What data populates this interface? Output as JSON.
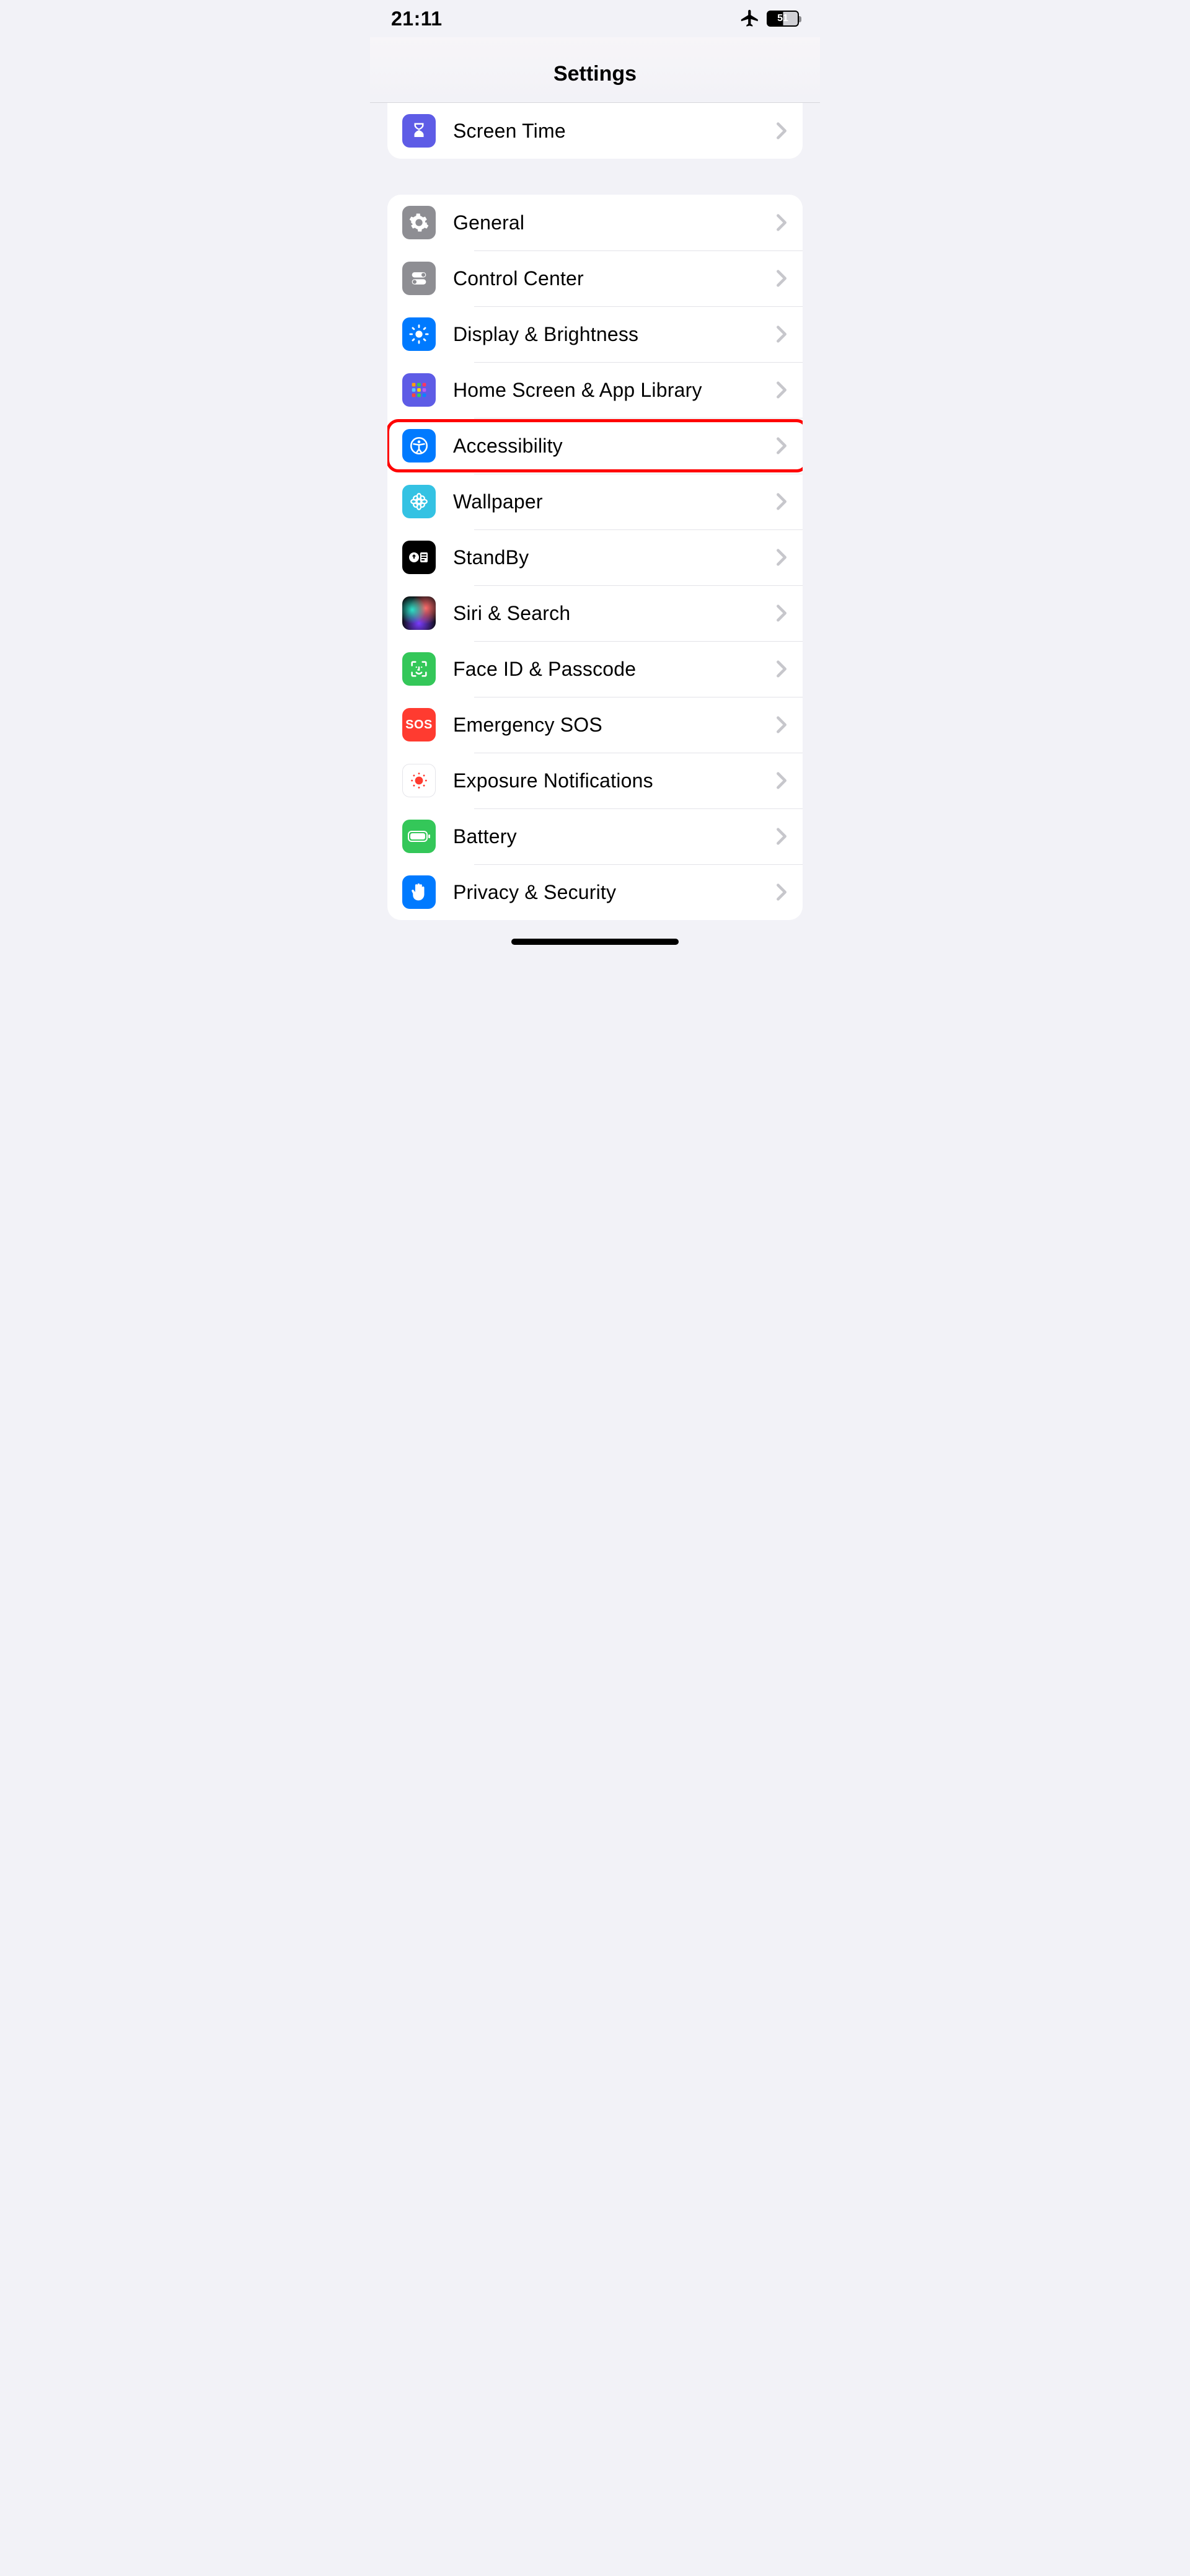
{
  "status": {
    "time": "21:11",
    "battery": "51"
  },
  "header": {
    "title": "Settings"
  },
  "group1": {
    "items": [
      {
        "label": "Screen Time",
        "icon": "hourglass-icon",
        "bg": "#5e5ce6"
      }
    ]
  },
  "group2": {
    "items": [
      {
        "label": "General",
        "icon": "gear-icon",
        "bg": "#8e8e93"
      },
      {
        "label": "Control Center",
        "icon": "switches-icon",
        "bg": "#8e8e93"
      },
      {
        "label": "Display & Brightness",
        "icon": "sun-icon",
        "bg": "#007aff"
      },
      {
        "label": "Home Screen & App Library",
        "icon": "app-grid-icon",
        "bg": "#5e5ce6"
      },
      {
        "label": "Accessibility",
        "icon": "accessibility-icon",
        "bg": "#007aff",
        "highlighted": true
      },
      {
        "label": "Wallpaper",
        "icon": "flower-icon",
        "bg": "#34c2e3"
      },
      {
        "label": "StandBy",
        "icon": "standby-icon",
        "bg": "#000000"
      },
      {
        "label": "Siri & Search",
        "icon": "siri-icon",
        "bg": "siri"
      },
      {
        "label": "Face ID & Passcode",
        "icon": "faceid-icon",
        "bg": "#34c759"
      },
      {
        "label": "Emergency SOS",
        "icon": "sos-icon",
        "bg": "#ff3b30"
      },
      {
        "label": "Exposure Notifications",
        "icon": "exposure-icon",
        "bg": "#ffffff",
        "border": true
      },
      {
        "label": "Battery",
        "icon": "battery-icon",
        "bg": "#34c759"
      },
      {
        "label": "Privacy & Security",
        "icon": "hand-icon",
        "bg": "#007aff"
      }
    ]
  }
}
